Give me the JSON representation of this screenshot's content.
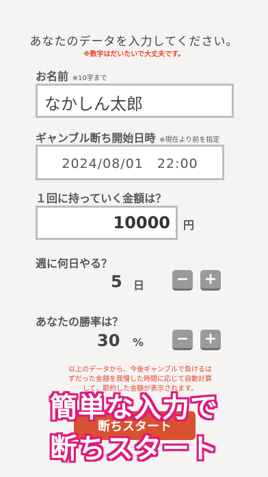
{
  "header": {
    "title": "あなたのデータを入力してください。",
    "note": "※数字はだいたいで大丈夫です。"
  },
  "name": {
    "label": "お名前",
    "hint": "※10字まで",
    "value": "なかしん太郎"
  },
  "start_datetime": {
    "label": "ギャンブル断ち開始日時",
    "hint": "※現在より前を指定",
    "value": "2024/08/01　22:00"
  },
  "amount": {
    "label": "１回に持っていく金額は？",
    "value": "10000",
    "unit": "円"
  },
  "days": {
    "label": "週に何日やる？",
    "value": "5",
    "unit": "日",
    "minus": "−",
    "plus": "+"
  },
  "win_rate": {
    "label": "あなたの勝率は？",
    "value": "30",
    "unit": "%",
    "minus": "−",
    "plus": "+"
  },
  "description": {
    "line1": "以上のデータから、今後ギャンブルで負けるは",
    "line2": "ずだった金額を我慢した時間に応じて自動計算",
    "line3": "して、節約した金額が表示されます。"
  },
  "start_button": {
    "label": "断ちスタート"
  },
  "promo": {
    "line1": "簡単な入力で",
    "line2": "断ちスタート"
  },
  "colors": {
    "accent_red": "#e8412b",
    "button_red": "#d9512f",
    "promo_pink": "#e0197a"
  }
}
